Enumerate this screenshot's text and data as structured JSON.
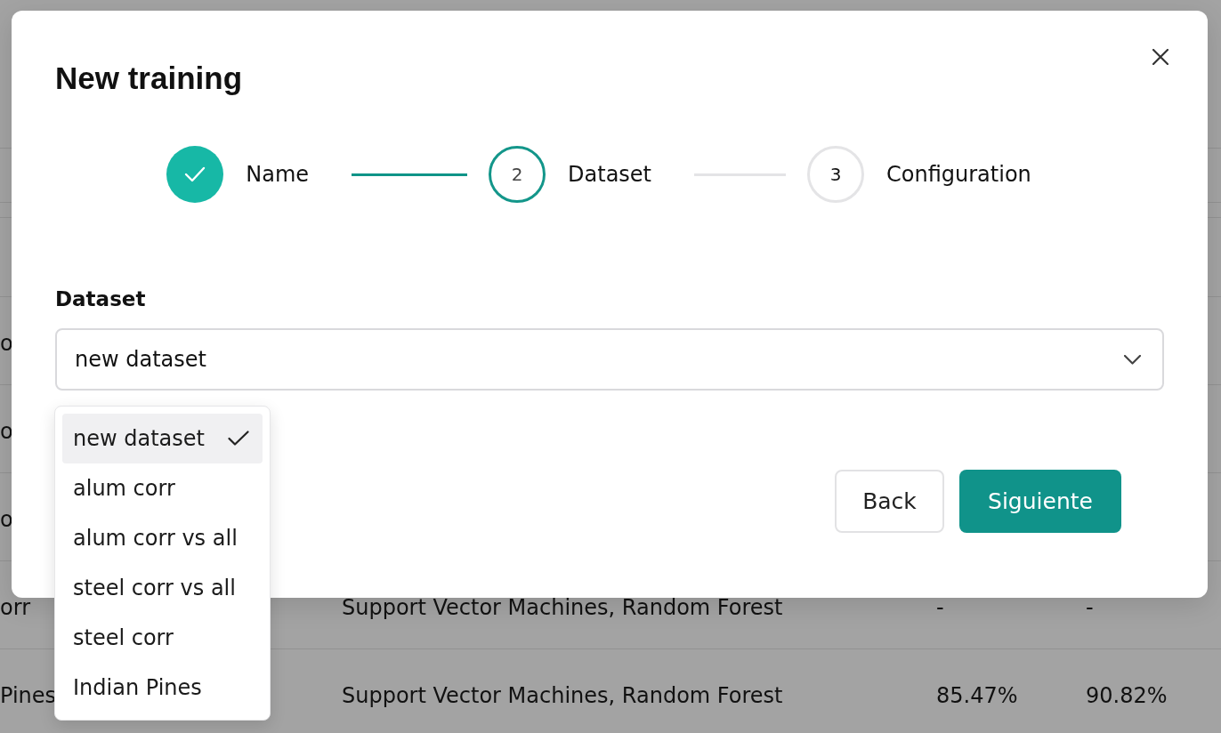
{
  "background_table": {
    "rows": [
      {
        "column_1": "o"
      },
      {
        "column_1": "o"
      },
      {
        "column_1": "o"
      },
      {
        "column_1": "orr",
        "column_2": "Support Vector Machines, Random Forest",
        "column_3": "-",
        "column_4": "-"
      },
      {
        "column_1": "Pines",
        "column_2": "Support Vector Machines, Random Forest",
        "column_3": "85.47%",
        "column_4": "90.82%"
      }
    ]
  },
  "dialog": {
    "title": "New training",
    "stepper": {
      "steps": [
        {
          "label": "Name",
          "completed": true,
          "selected": false
        },
        {
          "number": "2",
          "label": "Dataset",
          "completed": false,
          "selected": true
        },
        {
          "number": "3",
          "label": "Configuration",
          "completed": false,
          "selected": false
        }
      ]
    },
    "field": {
      "label": "Dataset",
      "value": "new dataset",
      "expanded": true,
      "options": [
        {
          "label": "new dataset",
          "selected": true
        },
        {
          "label": "alum corr",
          "selected": false
        },
        {
          "label": "alum corr vs all",
          "selected": false
        },
        {
          "label": "steel corr vs all",
          "selected": false
        },
        {
          "label": "steel corr",
          "selected": false
        },
        {
          "label": "Indian Pines",
          "selected": false
        }
      ]
    },
    "buttons": [
      {
        "kind": "secondary",
        "label": "Back"
      },
      {
        "kind": "primary",
        "label": "Siguiente"
      }
    ]
  }
}
